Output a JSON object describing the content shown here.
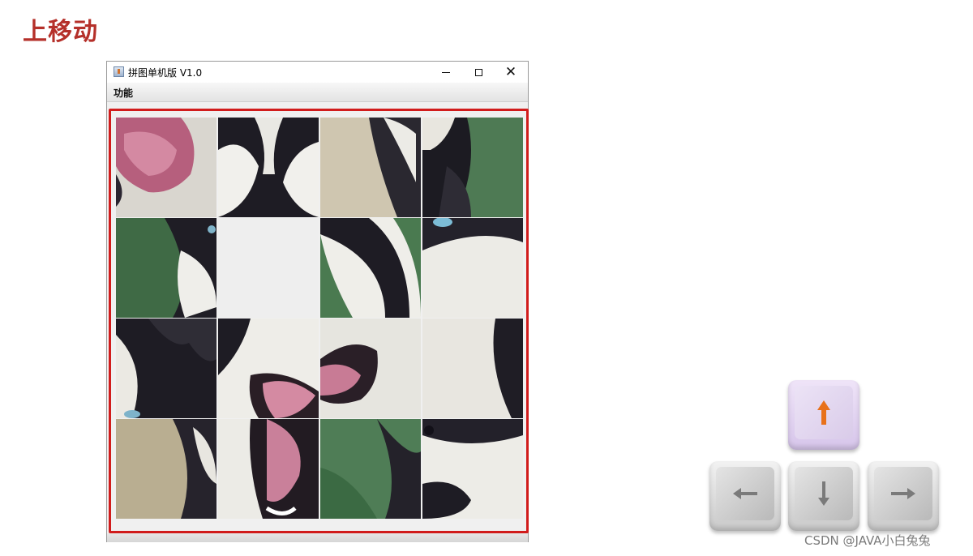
{
  "slide": {
    "title": "上移动"
  },
  "window": {
    "title": "拼图单机版 V1.0",
    "controls": {
      "minimize": "–",
      "maximize": "□",
      "close": "✕"
    },
    "menu": [
      "功能"
    ]
  },
  "board": {
    "rows": 4,
    "cols": 4,
    "empty_tile": {
      "row": 1,
      "col": 1
    }
  },
  "keys": {
    "up": {
      "glyph": "up-arrow",
      "active": true,
      "color": "#e8711a"
    },
    "left": {
      "glyph": "left-arrow",
      "active": false,
      "color": "#7a7a7a"
    },
    "down": {
      "glyph": "down-arrow",
      "active": false,
      "color": "#7a7a7a"
    },
    "right": {
      "glyph": "right-arrow",
      "active": false,
      "color": "#7a7a7a"
    }
  },
  "watermark": "CSDN @JAVA小白兔兔",
  "colors": {
    "title": "#b5302a",
    "highlight": "#d11c1c"
  }
}
